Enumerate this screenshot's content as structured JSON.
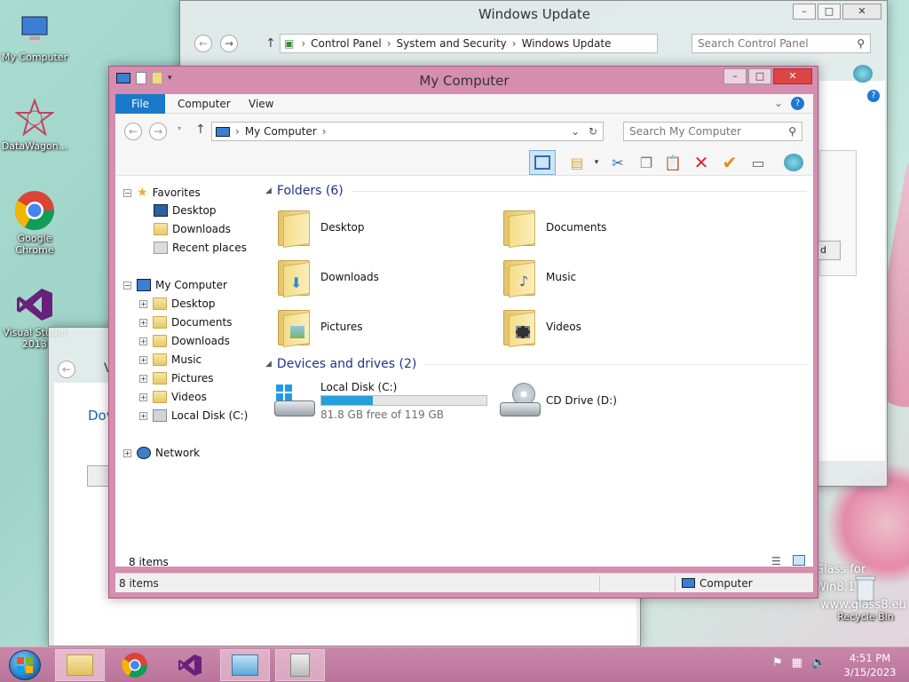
{
  "desktop": {
    "icons": [
      {
        "label": "My Computer"
      },
      {
        "label": "DataWagon..."
      },
      {
        "label": "Google Chrome"
      },
      {
        "label": "Visual Studio 2013"
      },
      {
        "label": "Recycle Bin"
      }
    ],
    "watermark_line1": "Glass for Win8.1",
    "watermark_line2": "www.glass8.eu"
  },
  "update_window": {
    "title": "Windows Update",
    "breadcrumb": [
      "Control Panel",
      "System and Security",
      "Windows Update"
    ],
    "search_placeholder": "Search Control Panel",
    "partial_button_text": "d"
  },
  "bg_window": {
    "partial_title": "V",
    "partial_text": "Dov"
  },
  "explorer": {
    "title": "My Computer",
    "ribbon_tabs": [
      "File",
      "Computer",
      "View"
    ],
    "address": "My Computer",
    "search_placeholder": "Search My Computer",
    "nav": {
      "favorites": "Favorites",
      "fav_items": [
        "Desktop",
        "Downloads",
        "Recent places"
      ],
      "mycomputer": "My Computer",
      "pc_items": [
        "Desktop",
        "Documents",
        "Downloads",
        "Music",
        "Pictures",
        "Videos",
        "Local Disk (C:)"
      ],
      "network": "Network"
    },
    "folders_header": "Folders (6)",
    "folders": [
      "Desktop",
      "Documents",
      "Downloads",
      "Music",
      "Pictures",
      "Videos"
    ],
    "drives_header": "Devices and drives (2)",
    "drives": [
      {
        "name": "Local Disk (C:)",
        "free": "81.8 GB free of 119 GB",
        "used_fraction": 0.31
      },
      {
        "name": "CD Drive (D:)"
      }
    ],
    "item_count": "8 items",
    "status_count": "8 items",
    "status_location": "Computer"
  },
  "clock": {
    "time": "4:51 PM",
    "date": "3/15/2023"
  },
  "colors": {
    "accent": "#1979ca",
    "frame": "#d58db0",
    "disk_bar": "#26a0da"
  }
}
